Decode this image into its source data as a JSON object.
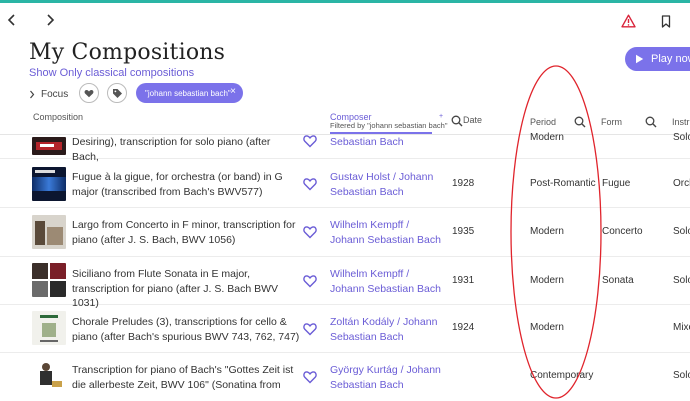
{
  "header": {
    "title": "My Compositions",
    "filter_link": "Show Only classical compositions",
    "focus_label": "Focus",
    "chip_label": "\"johann sebastian bach\"",
    "chip_close": "×",
    "play_label": "Play now",
    "accent_color": "#7b72ea",
    "top_bar_color": "#2ab5a5"
  },
  "columns": {
    "composition": "Composition",
    "composer": "Composer",
    "composer_filter": "Filtered by \"johann sebastian bach\"",
    "sort_indicator": "+",
    "date": "Date",
    "period": "Period",
    "form": "Form",
    "instrument": "Instr"
  },
  "rows": [
    {
      "work": "Desiring), transcription for solo piano (after Bach,",
      "composer": "Sebastian Bach",
      "date": "",
      "period": "Modern",
      "form": "",
      "instr": "Solo",
      "thumb": "red-piano"
    },
    {
      "work": "Fugue à la gigue, for orchestra (or band) in G major (transcribed from Bach's BWV577)",
      "composer": "Gustav Holst / Johann Sebastian Bach",
      "date": "1928",
      "period": "Post-Romantic",
      "form": "Fugue",
      "instr": "Orch",
      "thumb": "dark-blue"
    },
    {
      "work": "Largo from Concerto in F minor, transcription for piano (after J. S. Bach, BWV 1056)",
      "composer": "Wilhelm Kempff / Johann Sebastian Bach",
      "date": "1935",
      "period": "Modern",
      "form": "Concerto",
      "instr": "Solo",
      "thumb": "portrait"
    },
    {
      "work": "Siciliano from Flute Sonata in E major, transcription for piano (after J. S. Bach BWV 1031)",
      "composer": "Wilhelm Kempff / Johann Sebastian Bach",
      "date": "1931",
      "period": "Modern",
      "form": "Sonata",
      "instr": "Solo",
      "thumb": "grid"
    },
    {
      "work": "Chorale Preludes (3), transcriptions for cello & piano (after Bach's spurious BWV 743, 762, 747)",
      "composer": "Zoltán Kodály / Johann Sebastian Bach",
      "date": "1924",
      "period": "Modern",
      "form": "",
      "instr": "Mixe",
      "thumb": "light"
    },
    {
      "work": "Transcription for piano of Bach's \"Gottes Zeit ist die allerbeste Zeit,  BWV 106\" (Sonatina from",
      "composer": "György Kurtág / Johann Sebastian Bach",
      "date": "",
      "period": "Contemporary",
      "form": "",
      "instr": "Solo",
      "thumb": "figure"
    }
  ],
  "icons": {
    "back": "chevron-left-icon",
    "forward": "chevron-right-icon",
    "alert": "warning-triangle-icon",
    "bookmark": "bookmark-icon",
    "heart": "heart-icon",
    "tag": "tag-icon",
    "search": "search-icon",
    "play": "play-icon"
  },
  "annotation_color": "#e0242c"
}
